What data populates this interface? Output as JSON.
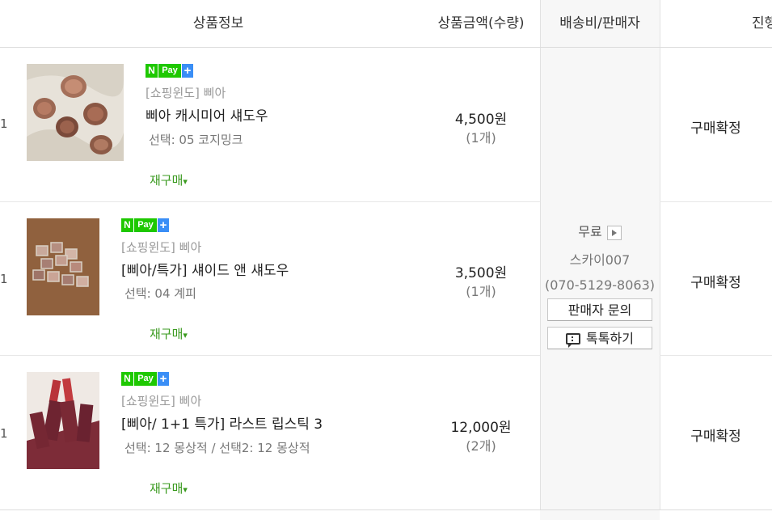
{
  "header": {
    "col_product": "상품정보",
    "col_price": "상품금액(수량)",
    "col_shipping": "배송비/판매자",
    "col_status": "진행"
  },
  "shipping": {
    "fee": "무료",
    "seller_name": "스카이007",
    "seller_phone": "(070-5129-8063)",
    "inquiry_button": "판매자 문의",
    "talk_button": "톡톡하기"
  },
  "npay": {
    "n": "N",
    "pay": "Pay",
    "plus": "+"
  },
  "items": [
    {
      "rownum": "1",
      "shop": "[쇼핑윈도] 삐아",
      "name": "삐아 캐시미어 섀도우",
      "option": "선택: 05 코지밍크",
      "rebuy": "재구매",
      "price": "4,500원",
      "qty": "(1개)",
      "status": "구매확정"
    },
    {
      "rownum": "1",
      "shop": "[쇼핑윈도] 삐아",
      "name": "[삐아/특가] 섀이드 앤 섀도우",
      "option": "선택: 04 계피",
      "rebuy": "재구매",
      "price": "3,500원",
      "qty": "(1개)",
      "status": "구매확정"
    },
    {
      "rownum": "1",
      "shop": "[쇼핑윈도] 삐아",
      "name": "[삐아/ 1+1 특가] 라스트 립스틱 3",
      "option": "선택: 12 몽상적 / 선택2: 12 몽상적",
      "rebuy": "재구매",
      "price": "12,000원",
      "qty": "(2개)",
      "status": "구매확정"
    }
  ]
}
